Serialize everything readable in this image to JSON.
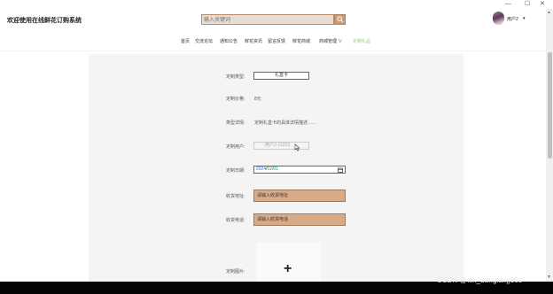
{
  "window": {
    "minimize": "—",
    "maximize": "☐",
    "close": "✕"
  },
  "header": {
    "site_title": "欢迎使用在线鲜花订购系统",
    "search_placeholder": "输入关键词",
    "username": "用户2",
    "caret": "▾"
  },
  "nav": {
    "items": [
      {
        "label": "首页"
      },
      {
        "label": "交流论坛"
      },
      {
        "label": "通知公告"
      },
      {
        "label": "鲜花资讯"
      },
      {
        "label": "留言反馈"
      },
      {
        "label": "鲜花商城"
      },
      {
        "label": "商城管理 ∨"
      },
      {
        "label": "定制礼品"
      }
    ]
  },
  "form": {
    "type_label": "定制类型:",
    "type_value": "礼盒卡",
    "price_label": "定制价格:",
    "price_value": "8元",
    "desc_label": "类型详情:",
    "desc_value": "定制礼盒卡的具体详情描述……",
    "user_label": "定制用户:",
    "user_value": "用户2-11223",
    "date_label": "定制日期:",
    "date_year": "2024",
    "date_sep1": "/",
    "date_month": "02",
    "date_sep2": "/",
    "date_day": "01",
    "address_label": "收货地址:",
    "address_placeholder": "请输入收货地址",
    "phone_label": "收货电话:",
    "phone_placeholder": "请输入收货电话",
    "image_label": "定制图片:",
    "upload_plus": "+"
  },
  "scroll": {
    "up": "▲",
    "down": "▼"
  },
  "watermark": "CSDN @wx_dangianjj889",
  "colors": {
    "accent_tan": "#d8aa88",
    "nav_active": "#9ac87a",
    "search_button": "#c89c78"
  }
}
